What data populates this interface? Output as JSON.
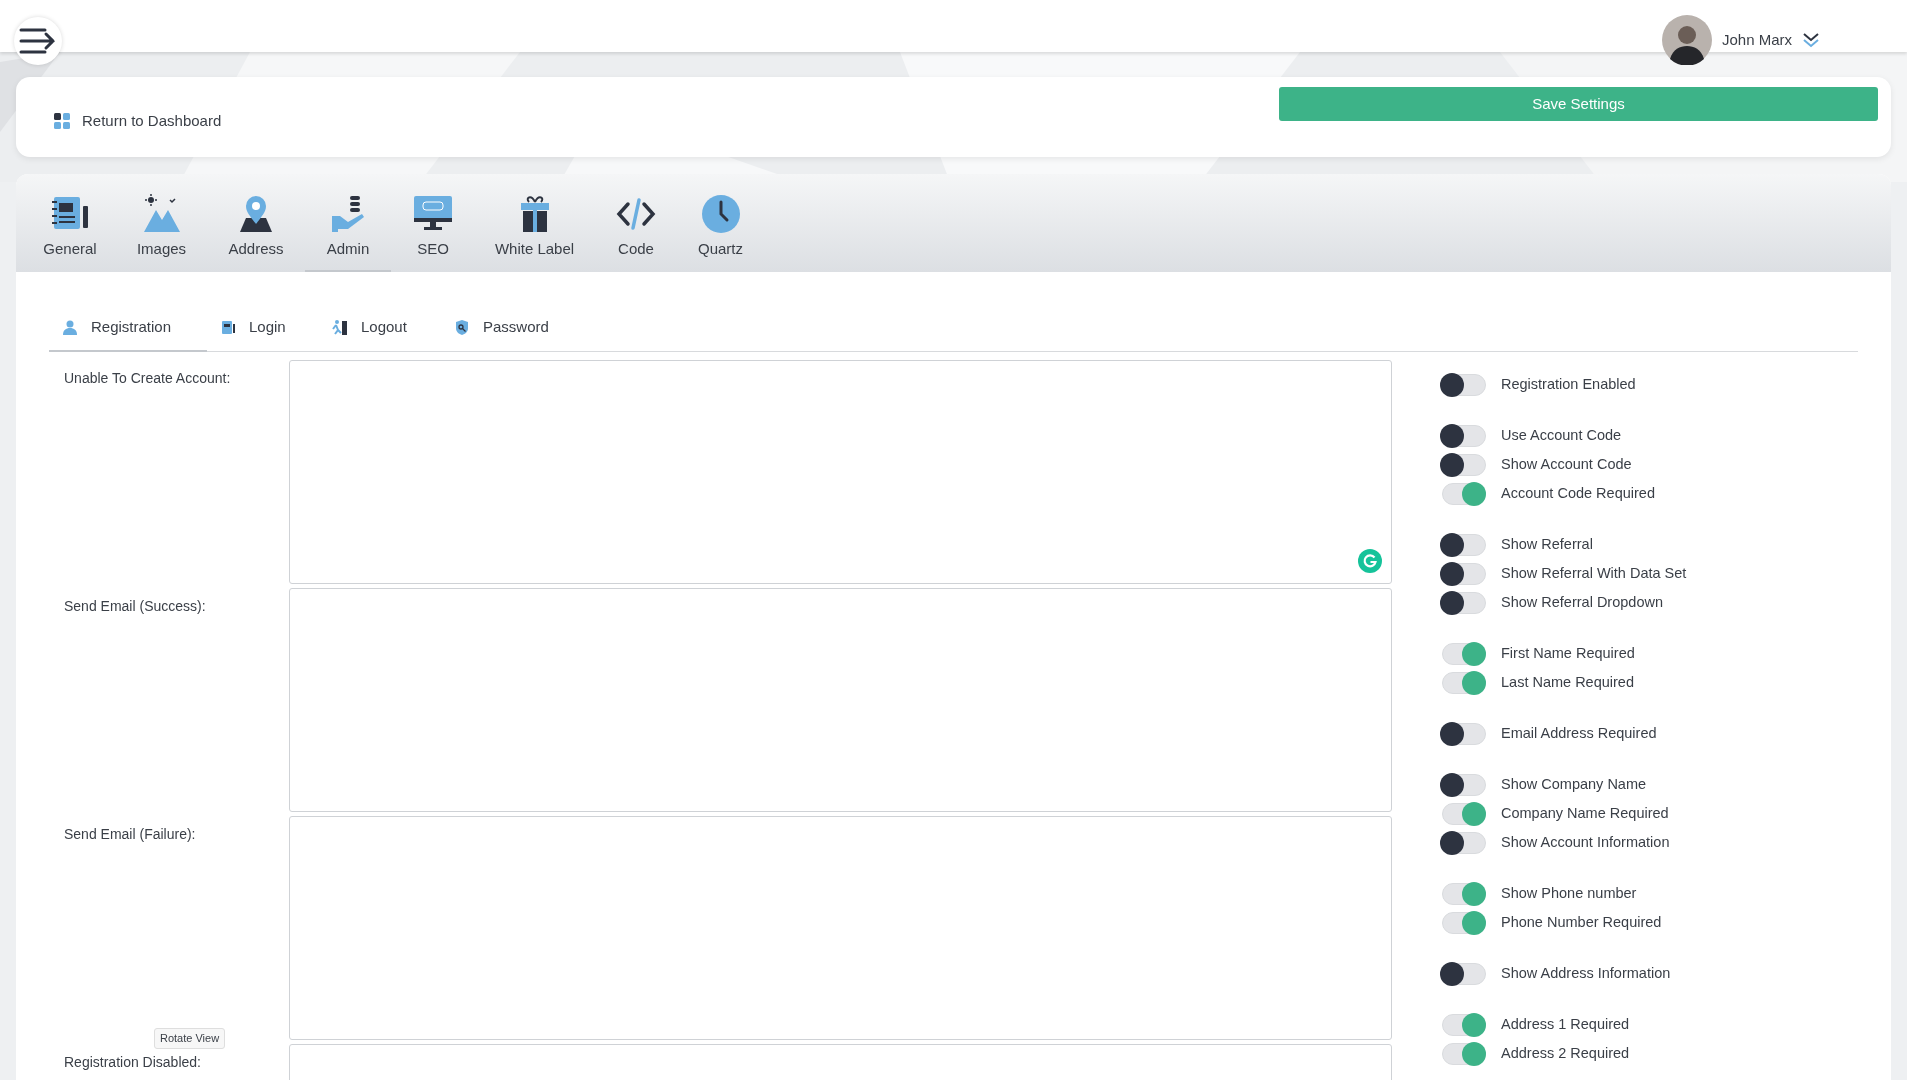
{
  "header": {
    "user_name": "John Marx"
  },
  "toolbar": {
    "return_link": "Return to Dashboard",
    "save_button": "Save Settings"
  },
  "tabs": [
    {
      "label": "General",
      "selected": false
    },
    {
      "label": "Images",
      "selected": false
    },
    {
      "label": "Address",
      "selected": false
    },
    {
      "label": "Admin",
      "selected": true
    },
    {
      "label": "SEO",
      "selected": false
    },
    {
      "label": "White Label",
      "selected": false
    },
    {
      "label": "Code",
      "selected": false
    },
    {
      "label": "Quartz",
      "selected": false
    }
  ],
  "subtabs": [
    {
      "label": "Registration",
      "selected": true
    },
    {
      "label": "Login",
      "selected": false
    },
    {
      "label": "Logout",
      "selected": false
    },
    {
      "label": "Password",
      "selected": false
    }
  ],
  "fields": [
    {
      "label": "Unable To Create Account:",
      "grammar_icon": true
    },
    {
      "label": "Send Email (Success):",
      "grammar_icon": false
    },
    {
      "label": "Send Email (Failure):",
      "grammar_icon": false
    },
    {
      "label": "Registration Disabled:",
      "grammar_icon": false
    }
  ],
  "toggle_groups": [
    [
      {
        "label": "Registration Enabled",
        "on": false
      }
    ],
    [
      {
        "label": "Use Account Code",
        "on": false
      },
      {
        "label": "Show Account Code",
        "on": false
      },
      {
        "label": "Account Code Required",
        "on": true
      }
    ],
    [
      {
        "label": "Show Referral",
        "on": false
      },
      {
        "label": "Show Referral With Data Set",
        "on": false
      },
      {
        "label": "Show Referral Dropdown",
        "on": false
      }
    ],
    [
      {
        "label": "First Name Required",
        "on": true
      },
      {
        "label": "Last Name Required",
        "on": true
      }
    ],
    [
      {
        "label": "Email Address Required",
        "on": false
      }
    ],
    [
      {
        "label": "Show Company Name",
        "on": false
      },
      {
        "label": "Company Name Required",
        "on": true
      },
      {
        "label": "Show Account Information",
        "on": false
      }
    ],
    [
      {
        "label": "Show Phone number",
        "on": true
      },
      {
        "label": "Phone Number Required",
        "on": true
      }
    ],
    [
      {
        "label": "Show Address Information",
        "on": false
      }
    ],
    [
      {
        "label": "Address 1 Required",
        "on": true
      },
      {
        "label": "Address 2 Required",
        "on": true
      }
    ]
  ],
  "tooltip": "Rotate View"
}
